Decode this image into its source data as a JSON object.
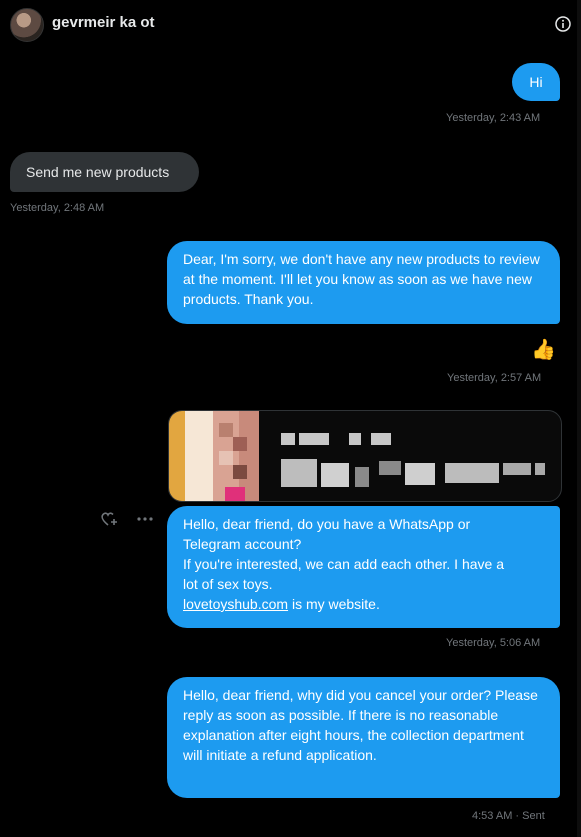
{
  "header": {
    "name": "gevrmeir ka ot",
    "info_icon": "info-icon"
  },
  "messages": [
    {
      "text": "Hi",
      "time": "Yesterday, 2:43 AM"
    },
    {
      "text": "Send me new products",
      "time": "Yesterday, 2:48 AM"
    },
    {
      "text": "Dear, I'm sorry, we don't have any new products to review at the moment. I'll let you know as soon as we have new products. Thank you."
    },
    {
      "reaction": "👍",
      "time": "Yesterday, 2:57 AM"
    },
    {
      "text_line1": "Hello, dear friend, do you have a WhatsApp or",
      "text_line2": "Telegram account?",
      "text_line3": "If you're interested, we can add each other. I have a",
      "text_line4": "lot of sex toys.",
      "link": "lovetoyshub.com",
      "text_after_link": " is my website.",
      "time": "Yesterday, 5:06 AM"
    },
    {
      "text": "Hello, dear friend, why did you cancel your order? Please reply as soon as possible. If there is no reasonable explanation after eight hours, the collection department will initiate a refund application.",
      "time": "4:53 AM · Sent"
    }
  ],
  "actions": {
    "react_icon": "heart-add-icon",
    "more_icon": "more-dots-icon"
  },
  "colors": {
    "outgoing": "#1d9bf0",
    "incoming": "#2f3336",
    "background": "#000000"
  }
}
